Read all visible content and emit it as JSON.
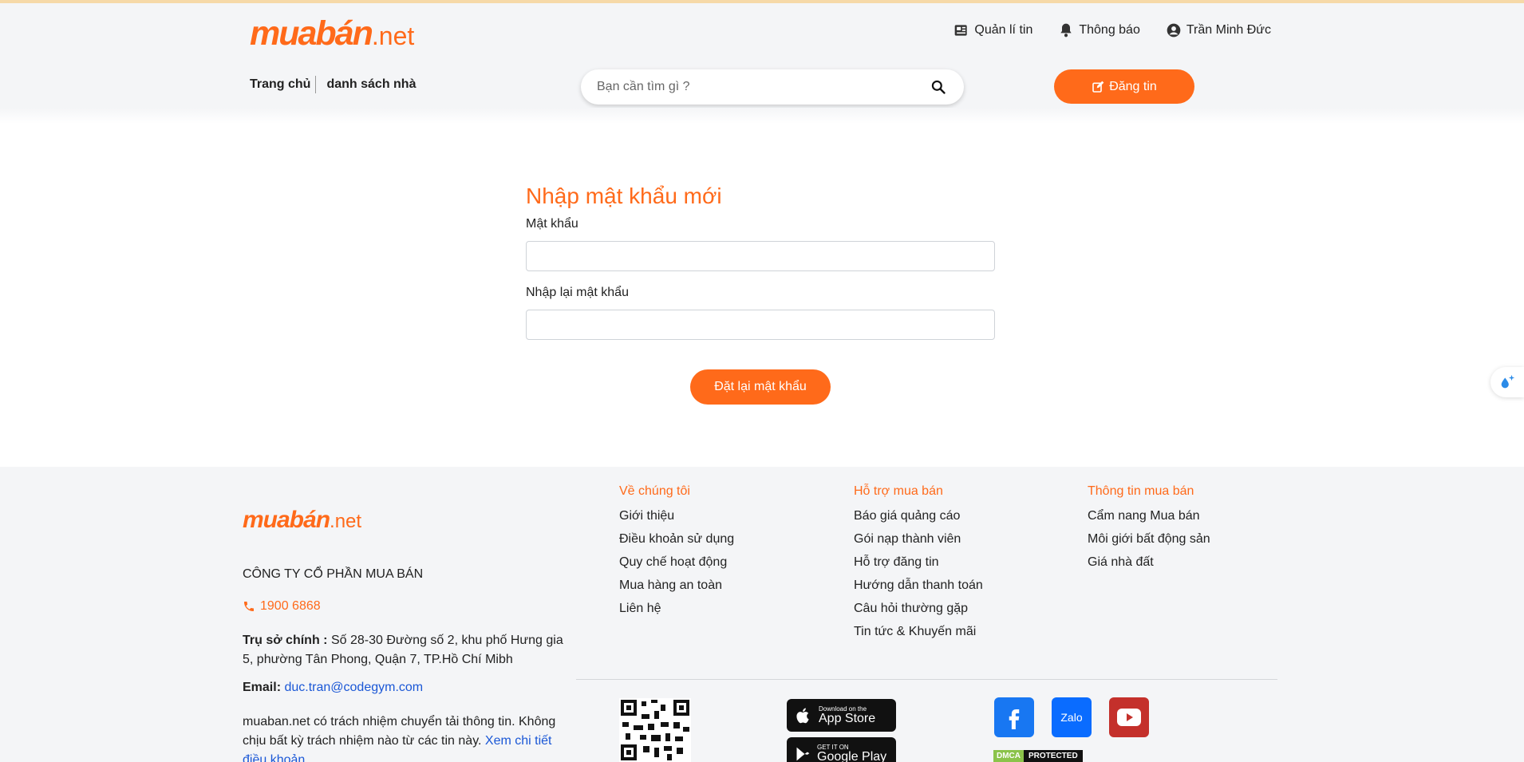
{
  "header": {
    "logo_brand": "muabán",
    "logo_tld": ".net",
    "top_links": {
      "manage": "Quản lí tin",
      "notifications": "Thông báo",
      "user": "Trần Minh Đức"
    },
    "breadcrumbs": [
      "Trang chủ",
      "danh sách nhà"
    ],
    "search_placeholder": "Bạn cần tìm gì ?",
    "post_button": "Đăng tin"
  },
  "form": {
    "title": "Nhập mật khẩu mới",
    "password_label": "Mật khẩu",
    "password_value": "",
    "confirm_label": "Nhập lại mật khẩu",
    "confirm_value": "",
    "submit_label": "Đặt lại mật khẩu"
  },
  "footer": {
    "logo_brand": "muabán",
    "logo_tld": ".net",
    "company": "CÔNG TY CỔ PHẦN MUA BÁN",
    "hotline": "1900 6868",
    "address_label": "Trụ sở chính :",
    "address": "Số 28-30 Đường số 2, khu phố Hưng gia 5, phường Tân Phong, Quận 7, TP.Hồ Chí Mibh",
    "email_label": "Email:",
    "email": "duc.tran@codegym.com",
    "disclaimer": "muaban.net có trách nhiệm chuyển tải thông tin. Không chịu bất kỳ trách nhiệm nào từ các tin này.",
    "disclaimer_link": "Xem chi tiết điều khoản",
    "columns": [
      {
        "title": "Về chúng tôi",
        "items": [
          "Giới thiệu",
          "Điều khoản sử dụng",
          "Quy chế hoạt động",
          "Mua hàng an toàn",
          "Liên hệ"
        ]
      },
      {
        "title": "Hỗ trợ mua bán",
        "items": [
          "Báo giá quảng cáo",
          "Gói nạp thành viên",
          "Hỗ trợ đăng tin",
          "Hướng dẫn thanh toán",
          "Câu hỏi thường gặp",
          "Tin tức & Khuyến mãi"
        ]
      },
      {
        "title": "Thông tin mua bán",
        "items": [
          "Cẩm nang Mua bán",
          "Môi giới bất động sản",
          "Giá nhà đất"
        ]
      }
    ],
    "app_store": {
      "small": "Download on the",
      "big": "App Store"
    },
    "google_play": {
      "small": "GET IT ON",
      "big": "Google Play"
    },
    "zalo_label": "Zalo",
    "dmca": [
      "DMCA",
      "PROTECTED"
    ]
  },
  "colors": {
    "accent": "#ff6a1a",
    "header_bg": "#f4f5f7",
    "link_blue": "#1a57d6"
  },
  "icons": {
    "manage": "newspaper-icon",
    "notifications": "bell-icon",
    "user": "user-circle-icon",
    "search": "search-icon",
    "post": "edit-icon",
    "hotline": "phone-icon",
    "float": "ai-sparkle-icon"
  }
}
